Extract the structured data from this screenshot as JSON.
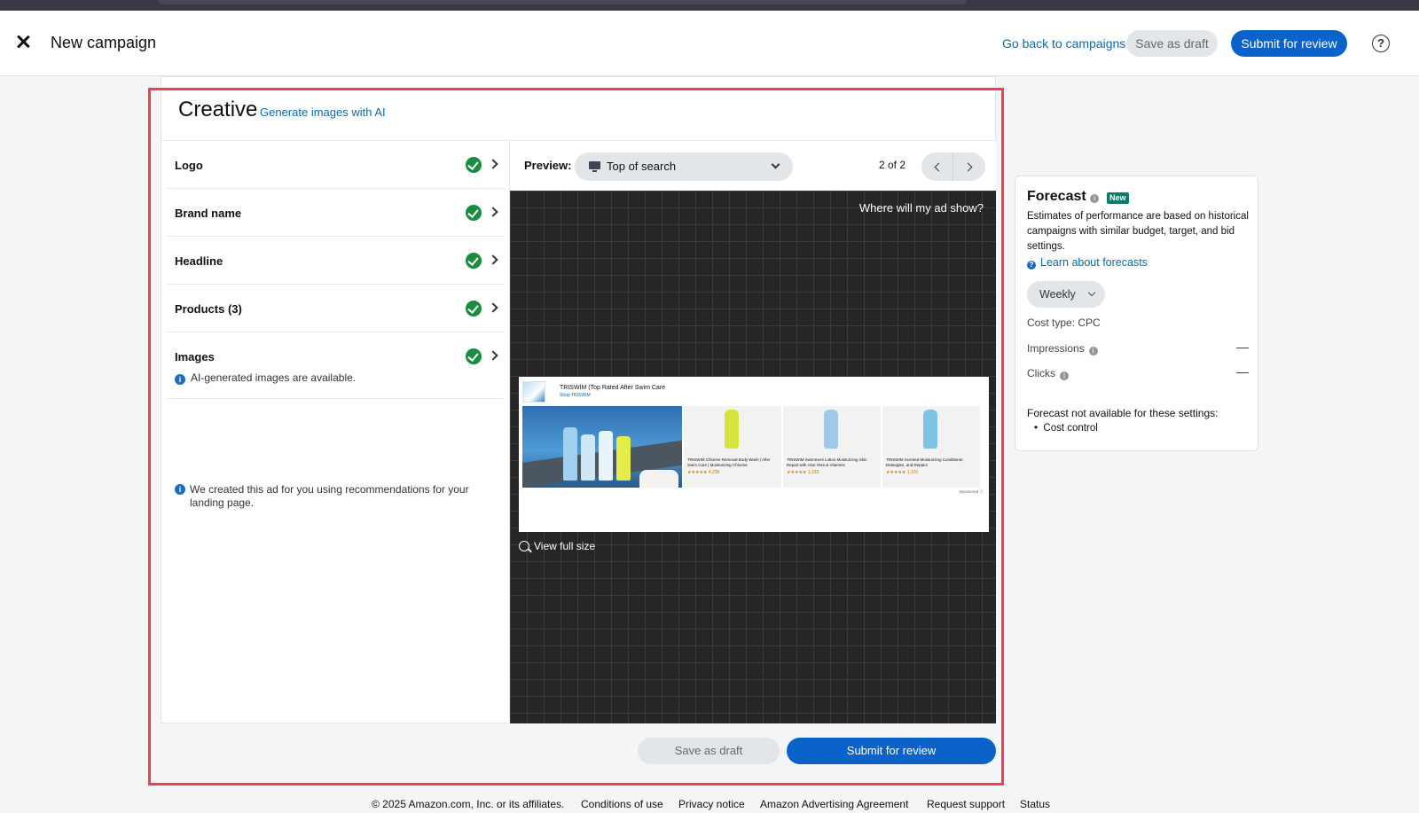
{
  "header": {
    "title": "New campaign",
    "back_link": "Go back to campaigns",
    "save_draft": "Save as draft",
    "submit": "Submit for review",
    "help_glyph": "?"
  },
  "creative": {
    "title": "Creative",
    "generate_link": "Generate images with AI",
    "sections": [
      {
        "label": "Logo",
        "status": "complete"
      },
      {
        "label": "Brand name",
        "status": "complete"
      },
      {
        "label": "Headline",
        "status": "complete"
      },
      {
        "label": "Products (3)",
        "status": "complete"
      },
      {
        "label": "Images",
        "status": "complete",
        "note": "AI-generated images are available."
      }
    ],
    "recommendation_note": "We created this ad for you using recommendations for your landing page."
  },
  "preview": {
    "label": "Preview:",
    "placement": "Top of search",
    "page_indicator": "2 of 2",
    "where_link": "Where will my ad show?",
    "view_full_size": "View full size",
    "ad": {
      "brand_headline": "TRISWIM (Top Rated After Swim Care",
      "shop_link": "Shop TRISWIM",
      "products": [
        {
          "title": "TRISWIM Chlorine Removal Body Wash | After Swim Care | Moisturizing Chlorine",
          "rating": "★★★★★ 4,236",
          "color": "#d8e23a"
        },
        {
          "title": "TRISWIM Swimmers Lotion Moisturizing Skin Repair with Aloe Vera & Vitamins",
          "rating": "★★★★★ 1,333",
          "color": "#9ec9e8"
        },
        {
          "title": "TRISWIM Scented Moisturizing Conditioner, Detangles, and Repairs",
          "rating": "★★★★★ 1,101",
          "color": "#7cc3e6"
        }
      ],
      "sponsored": "Sponsored ⓘ"
    }
  },
  "actions": {
    "save_draft": "Save as draft",
    "submit": "Submit for review"
  },
  "forecast": {
    "title": "Forecast",
    "badge": "New",
    "description": "Estimates of performance are based on historical campaigns with similar budget, target, and bid settings.",
    "learn_link": "Learn about forecasts",
    "period": "Weekly",
    "cost_type": "Cost type: CPC",
    "metrics": [
      {
        "label": "Impressions",
        "value": "—"
      },
      {
        "label": "Clicks",
        "value": "—"
      }
    ],
    "not_available": "Forecast not available for these settings:",
    "reasons": [
      "Cost control"
    ]
  },
  "footer": {
    "copyright": "© 2025 Amazon.com, Inc. or its affiliates.",
    "links": [
      "Conditions of use",
      "Privacy notice",
      "Amazon Advertising Agreement",
      "Request support",
      "Status"
    ]
  },
  "colors": {
    "primary": "#0b63c9",
    "link": "#0c6aa8",
    "success": "#1a8c3e",
    "highlight": "#ef4150",
    "new_badge": "#0d7a6b"
  }
}
